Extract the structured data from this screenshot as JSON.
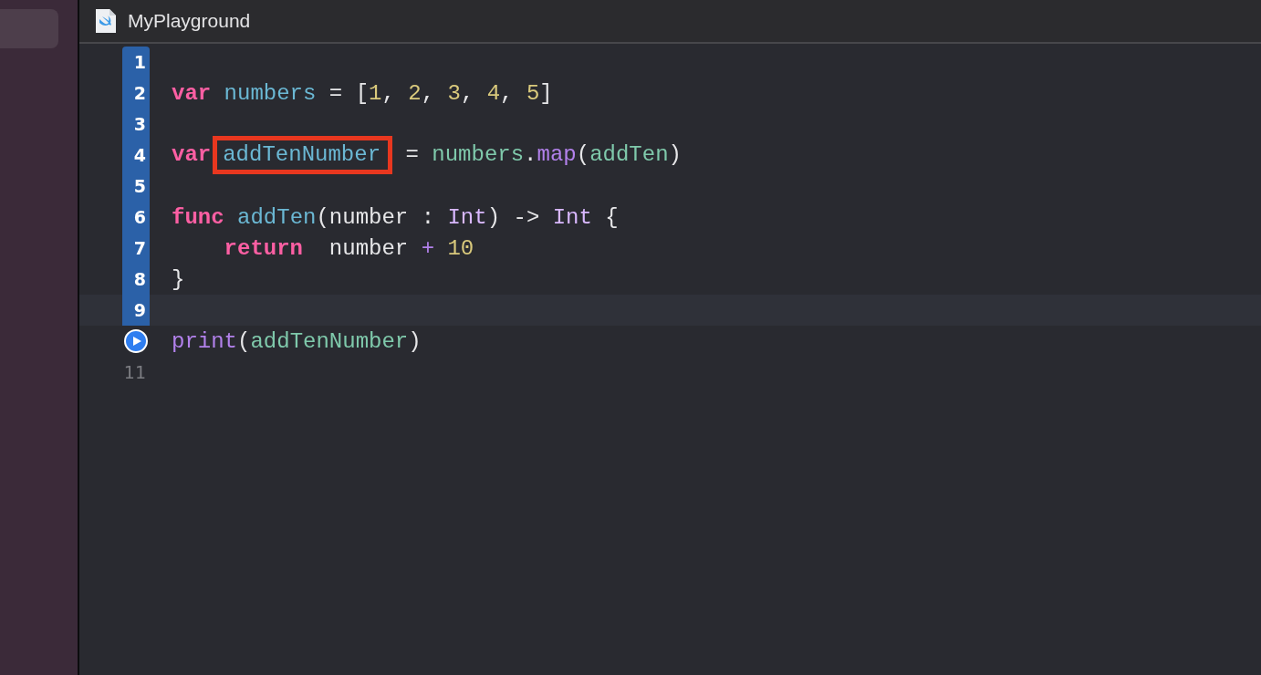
{
  "tab": {
    "title": "MyPlayground"
  },
  "lines": [
    {
      "number": "1",
      "executed": true
    },
    {
      "number": "2",
      "executed": true,
      "tokens": [
        {
          "kind": "keyword",
          "text": "var "
        },
        {
          "kind": "declared",
          "text": "numbers"
        },
        {
          "kind": "plain",
          "text": " = ["
        },
        {
          "kind": "number",
          "text": "1"
        },
        {
          "kind": "plain",
          "text": ", "
        },
        {
          "kind": "number",
          "text": "2"
        },
        {
          "kind": "plain",
          "text": ", "
        },
        {
          "kind": "number",
          "text": "3"
        },
        {
          "kind": "plain",
          "text": ", "
        },
        {
          "kind": "number",
          "text": "4"
        },
        {
          "kind": "plain",
          "text": ", "
        },
        {
          "kind": "number",
          "text": "5"
        },
        {
          "kind": "plain",
          "text": "]"
        }
      ]
    },
    {
      "number": "3",
      "executed": true
    },
    {
      "number": "4",
      "executed": true,
      "tokens": [
        {
          "kind": "keyword",
          "text": "var"
        },
        {
          "kind": "declared",
          "text": "addTenNumber",
          "highlighted": true
        },
        {
          "kind": "plain",
          "text": " = "
        },
        {
          "kind": "project",
          "text": "numbers"
        },
        {
          "kind": "plain",
          "text": "."
        },
        {
          "kind": "library",
          "text": "map"
        },
        {
          "kind": "plain",
          "text": "("
        },
        {
          "kind": "project",
          "text": "addTen"
        },
        {
          "kind": "plain",
          "text": ")"
        }
      ]
    },
    {
      "number": "5",
      "executed": true
    },
    {
      "number": "6",
      "executed": true,
      "tokens": [
        {
          "kind": "keyword",
          "text": "func "
        },
        {
          "kind": "declared",
          "text": "addTen"
        },
        {
          "kind": "plain",
          "text": "(number : "
        },
        {
          "kind": "type",
          "text": "Int"
        },
        {
          "kind": "plain",
          "text": ") -> "
        },
        {
          "kind": "type",
          "text": "Int"
        },
        {
          "kind": "plain",
          "text": " {"
        }
      ]
    },
    {
      "number": "7",
      "executed": true,
      "tokens": [
        {
          "kind": "keyword",
          "text": "    return"
        },
        {
          "kind": "plain",
          "text": "  number "
        },
        {
          "kind": "library",
          "text": "+ "
        },
        {
          "kind": "number",
          "text": "10"
        }
      ]
    },
    {
      "number": "8",
      "executed": true,
      "tokens": [
        {
          "kind": "plain",
          "text": "}"
        }
      ]
    },
    {
      "number": "9",
      "executed": true,
      "current": true
    },
    {
      "executed": true,
      "run": true,
      "tokens": [
        {
          "kind": "library",
          "text": "print"
        },
        {
          "kind": "plain",
          "text": "("
        },
        {
          "kind": "project",
          "text": "addTenNumber"
        },
        {
          "kind": "plain",
          "text": ")"
        }
      ]
    },
    {
      "number": "11",
      "executed": false
    }
  ]
}
